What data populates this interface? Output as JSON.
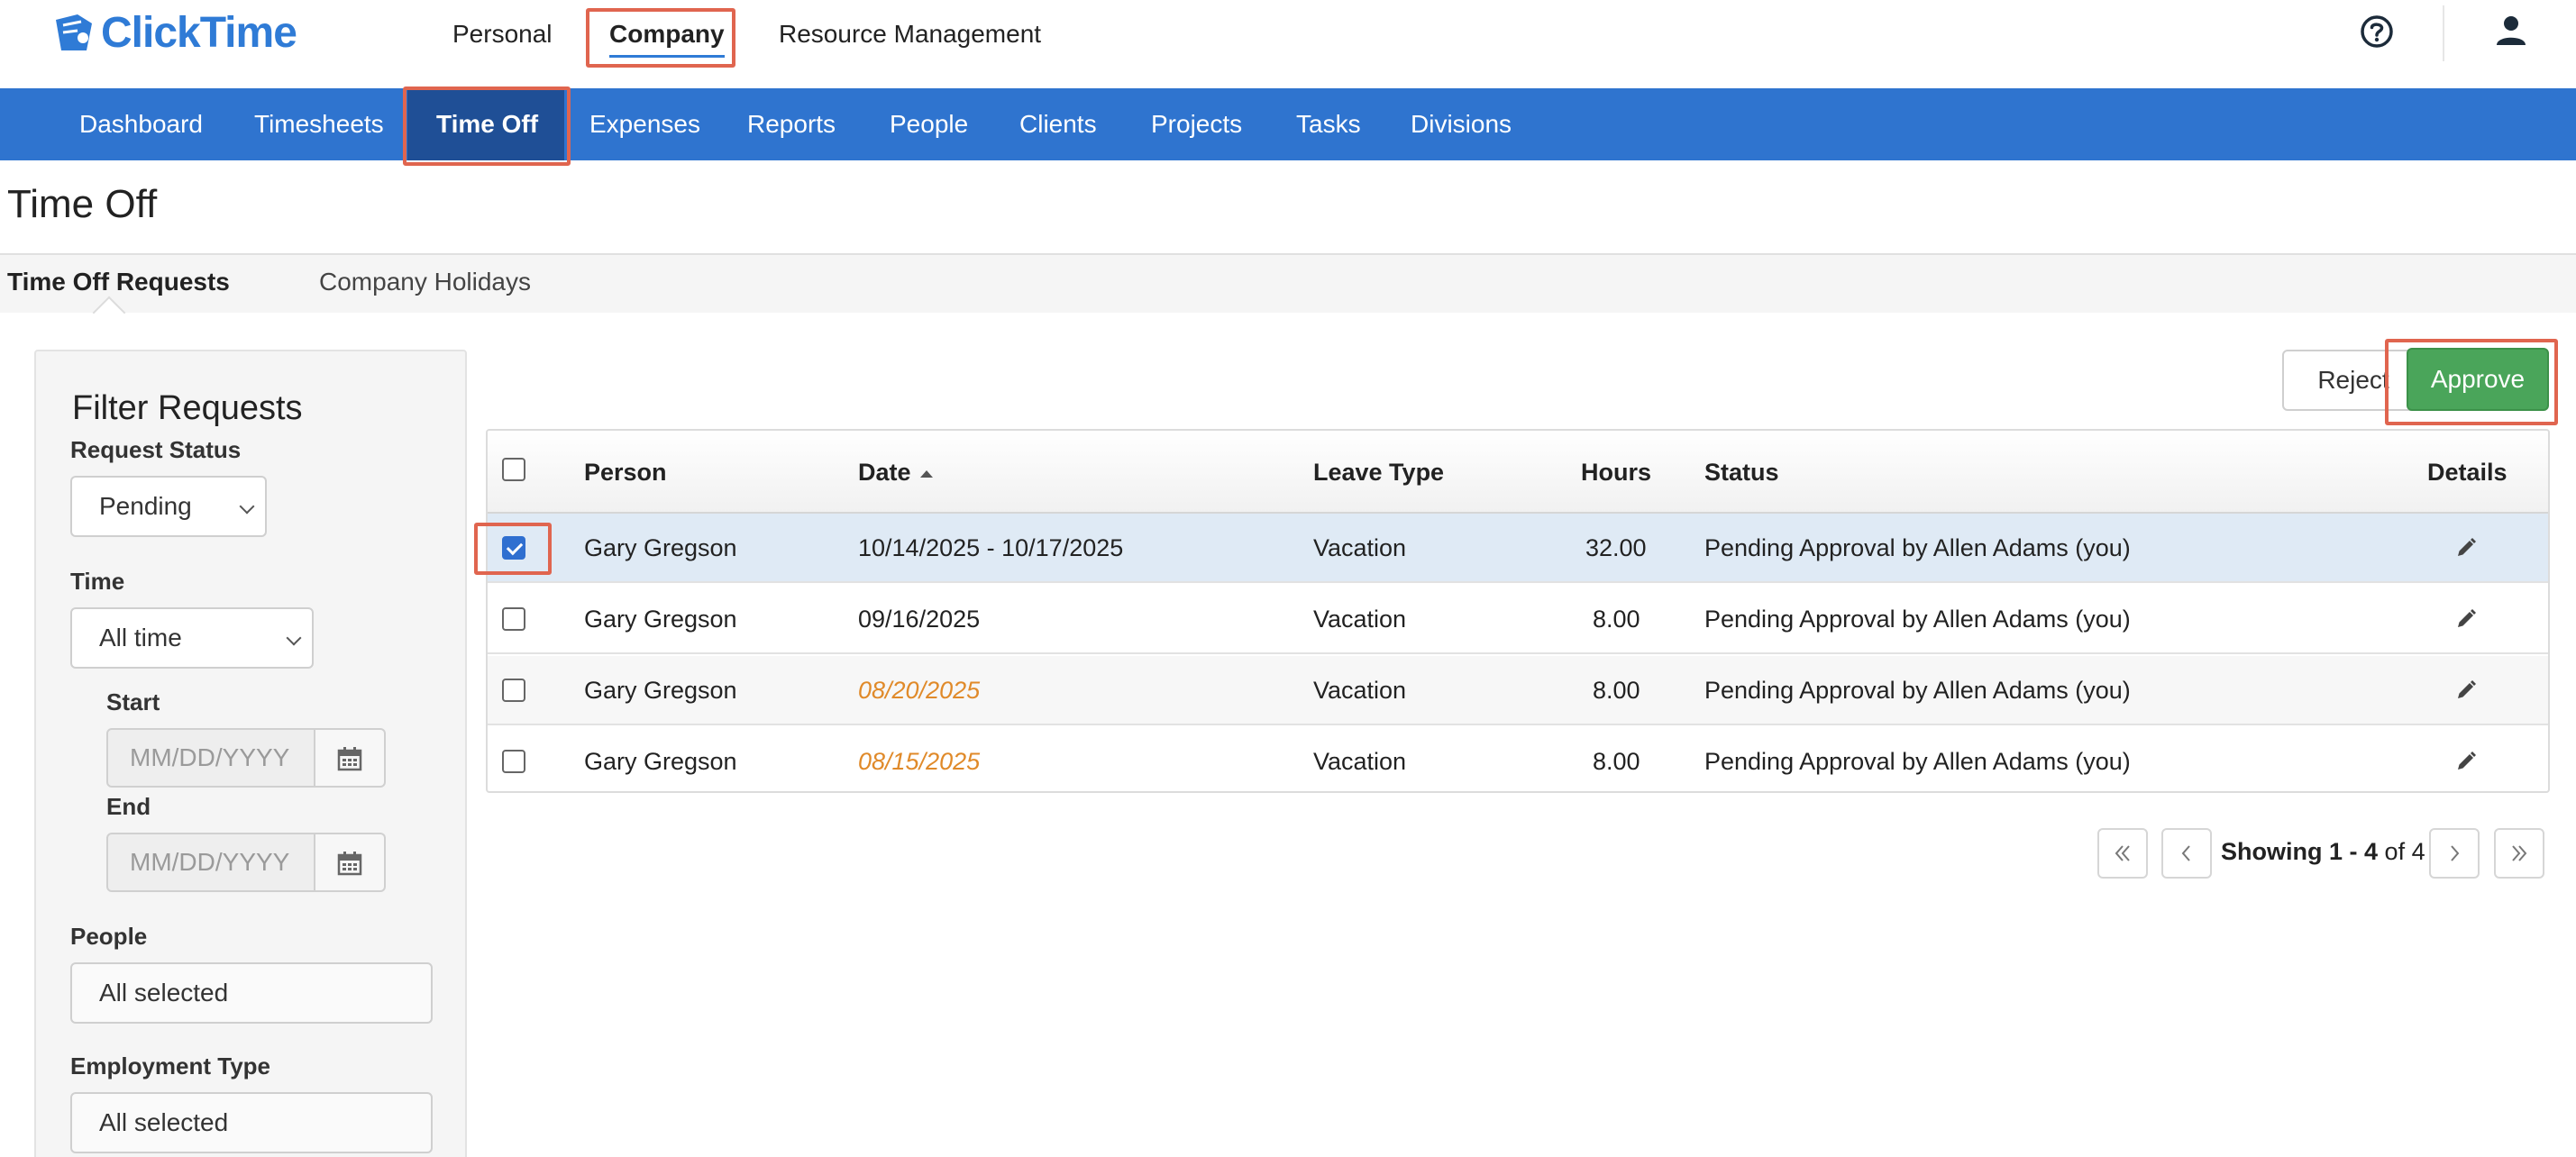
{
  "brand": {
    "name": "ClickTime",
    "accent": "#2f7bd6"
  },
  "top_nav": {
    "items": [
      {
        "label": "Personal"
      },
      {
        "label": "Company",
        "active": true
      },
      {
        "label": "Resource Management"
      }
    ]
  },
  "top_icons": {
    "help": "help-icon",
    "user": "user-icon"
  },
  "main_nav": {
    "items": [
      {
        "label": "Dashboard"
      },
      {
        "label": "Timesheets"
      },
      {
        "label": "Time Off",
        "active": true
      },
      {
        "label": "Expenses"
      },
      {
        "label": "Reports"
      },
      {
        "label": "People"
      },
      {
        "label": "Clients"
      },
      {
        "label": "Projects"
      },
      {
        "label": "Tasks"
      },
      {
        "label": "Divisions"
      }
    ]
  },
  "page": {
    "title": "Time Off",
    "tabs": [
      {
        "label": "Time Off Requests",
        "active": true
      },
      {
        "label": "Company Holidays"
      }
    ]
  },
  "filter": {
    "title": "Filter Requests",
    "request_status": {
      "label": "Request Status",
      "value": "Pending"
    },
    "time": {
      "label": "Time",
      "value": "All time"
    },
    "start": {
      "label": "Start",
      "placeholder": "MM/DD/YYYY"
    },
    "end": {
      "label": "End",
      "placeholder": "MM/DD/YYYY"
    },
    "people": {
      "label": "People",
      "value": "All selected"
    },
    "employment_type": {
      "label": "Employment Type",
      "value": "All selected"
    }
  },
  "actions": {
    "reject": "Reject",
    "approve": "Approve"
  },
  "table": {
    "headers": {
      "person": "Person",
      "date": "Date",
      "leave_type": "Leave Type",
      "hours": "Hours",
      "status": "Status",
      "details": "Details"
    },
    "rows": [
      {
        "checked": true,
        "person": "Gary Gregson",
        "date": "10/14/2025 - 10/17/2025",
        "date_past": false,
        "leave_type": "Vacation",
        "hours": "32.00",
        "status": "Pending Approval by Allen Adams (you)"
      },
      {
        "checked": false,
        "person": "Gary Gregson",
        "date": "09/16/2025",
        "date_past": false,
        "leave_type": "Vacation",
        "hours": "8.00",
        "status": "Pending Approval by Allen Adams (you)"
      },
      {
        "checked": false,
        "person": "Gary Gregson",
        "date": "08/20/2025",
        "date_past": true,
        "leave_type": "Vacation",
        "hours": "8.00",
        "status": "Pending Approval by Allen Adams (you)"
      },
      {
        "checked": false,
        "person": "Gary Gregson",
        "date": "08/15/2025",
        "date_past": true,
        "leave_type": "Vacation",
        "hours": "8.00",
        "status": "Pending Approval by Allen Adams (you)"
      }
    ]
  },
  "pagination": {
    "showing_label": "Showing",
    "range": "1 - 4",
    "of_label": "of",
    "total": "4"
  },
  "colors": {
    "nav_blue": "#2f74cf",
    "nav_active": "#1f4f96",
    "approve_green": "#4aa55a",
    "past_date_orange": "#e08a2a",
    "highlight_red": "#e0654f"
  }
}
